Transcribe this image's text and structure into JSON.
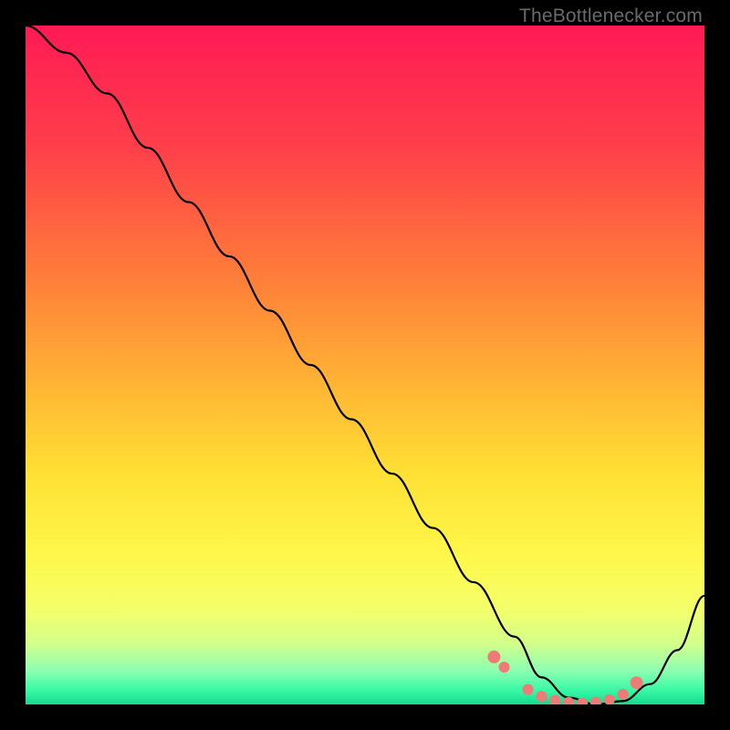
{
  "watermark": "TheBottlenecker.com",
  "chart_data": {
    "type": "line",
    "title": "",
    "xlabel": "",
    "ylabel": "",
    "xlim": [
      0,
      100
    ],
    "ylim": [
      0,
      100
    ],
    "series": [
      {
        "name": "bottleneck-curve",
        "x": [
          0,
          6,
          12,
          18,
          24,
          30,
          36,
          42,
          48,
          54,
          60,
          66,
          72,
          76,
          80,
          84,
          88,
          92,
          96,
          100
        ],
        "y": [
          100,
          96,
          90,
          82,
          74,
          66,
          58,
          50,
          42,
          34,
          26,
          18,
          10,
          4,
          1,
          0,
          0.5,
          3,
          8,
          16
        ]
      }
    ],
    "markers": {
      "name": "highlight-dots",
      "x": [
        69,
        70.5,
        74,
        76,
        78,
        80,
        82,
        84,
        86,
        88,
        90
      ],
      "y": [
        7,
        5.5,
        2.2,
        1.2,
        0.6,
        0.3,
        0.2,
        0.3,
        0.7,
        1.5,
        3.2
      ]
    },
    "gradient_stops": [
      {
        "offset": 0,
        "color": "#ff1a55"
      },
      {
        "offset": 18,
        "color": "#ff3f4a"
      },
      {
        "offset": 36,
        "color": "#ff7a3a"
      },
      {
        "offset": 52,
        "color": "#ffb134"
      },
      {
        "offset": 66,
        "color": "#ffe034"
      },
      {
        "offset": 78,
        "color": "#fff74a"
      },
      {
        "offset": 86,
        "color": "#f4ff6a"
      },
      {
        "offset": 91,
        "color": "#d3ff8a"
      },
      {
        "offset": 95,
        "color": "#8dffb0"
      },
      {
        "offset": 98,
        "color": "#36f8a6"
      },
      {
        "offset": 100,
        "color": "#17d98d"
      }
    ]
  }
}
